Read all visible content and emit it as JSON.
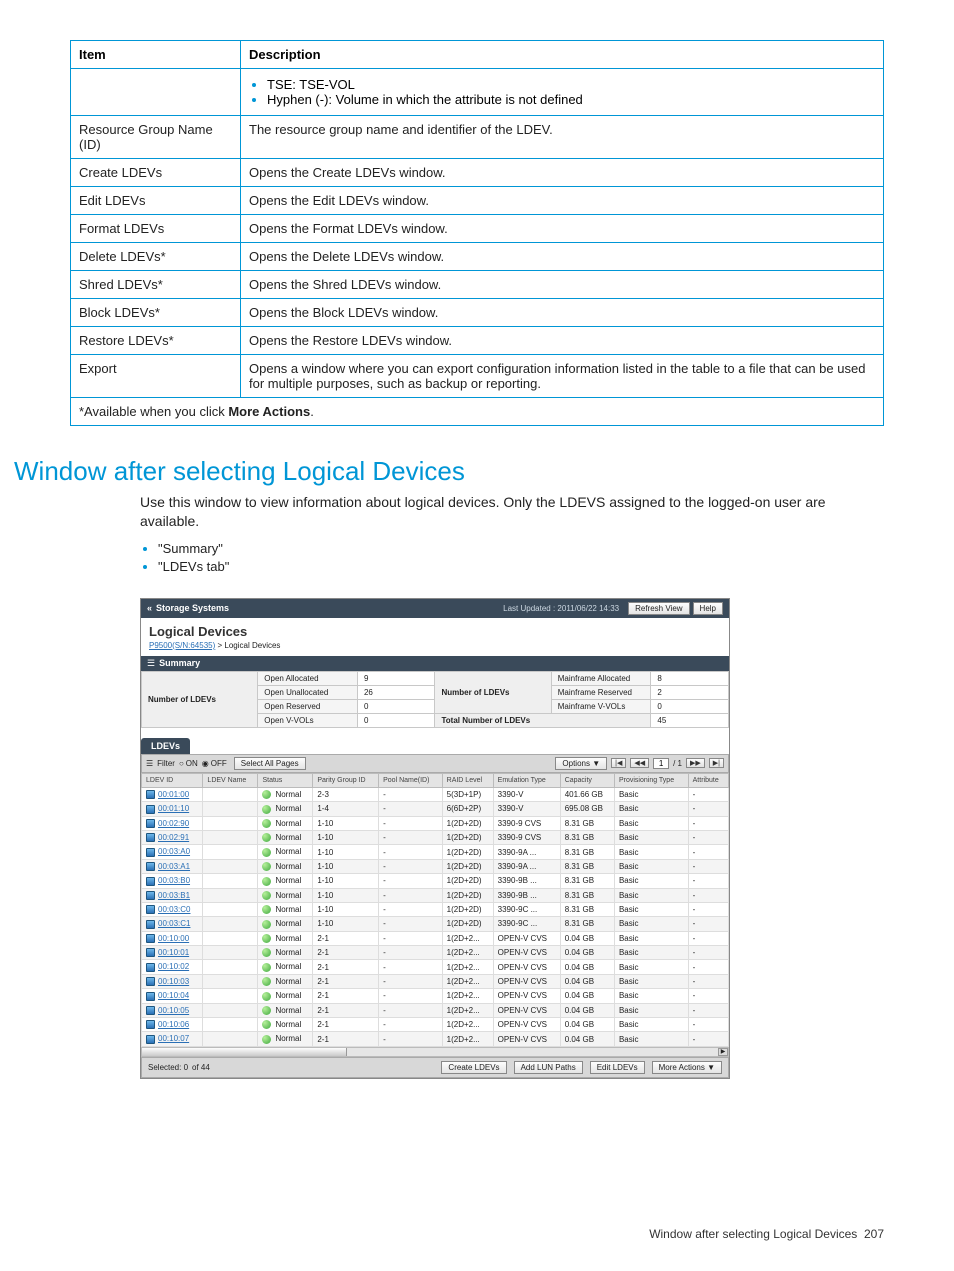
{
  "def_table": {
    "headers": [
      "Item",
      "Description"
    ],
    "rows": [
      {
        "item": "",
        "desc_list": [
          "TSE: TSE-VOL",
          "Hyphen (-): Volume in which the attribute is not defined"
        ]
      },
      {
        "item": "Resource Group Name (ID)",
        "desc": "The resource group name and identifier of the LDEV."
      },
      {
        "item": "Create LDEVs",
        "desc": "Opens the Create LDEVs window."
      },
      {
        "item": "Edit LDEVs",
        "desc": "Opens the Edit LDEVs window."
      },
      {
        "item": "Format LDEVs",
        "desc": "Opens the Format LDEVs window."
      },
      {
        "item": "Delete LDEVs*",
        "desc": "Opens the Delete LDEVs window."
      },
      {
        "item": "Shred LDEVs*",
        "desc": "Opens the Shred LDEVs window."
      },
      {
        "item": "Block LDEVs*",
        "desc": "Opens the Block LDEVs window."
      },
      {
        "item": "Restore LDEVs*",
        "desc": "Opens the Restore LDEVs window."
      },
      {
        "item": "Export",
        "desc": "Opens a window where you can export configuration information listed in the table to a file that can be used for multiple purposes, such as backup or reporting."
      }
    ],
    "footnote_prefix": "*Available when you click ",
    "footnote_bold": "More Actions",
    "footnote_suffix": "."
  },
  "section_title": "Window after selecting Logical Devices",
  "section_desc": "Use this window to view information about logical devices. Only the LDEVS assigned to the logged-on user are available.",
  "section_links": [
    "\"Summary\"",
    "\"LDEVs tab\""
  ],
  "app": {
    "back_label": "Storage Systems",
    "last_updated": "Last Updated : 2011/06/22 14:33",
    "refresh": "Refresh View",
    "help": "Help",
    "title": "Logical Devices",
    "breadcrumb_link": "P9500(S/N:64535)",
    "breadcrumb_sep": " > ",
    "breadcrumb_current": "Logical Devices",
    "summary_label": "Summary",
    "summary": {
      "left_label": "Number of LDEVs",
      "left_rows": [
        {
          "sub": "Open Allocated",
          "val": "9"
        },
        {
          "sub": "Open Unallocated",
          "val": "26"
        },
        {
          "sub": "Open Reserved",
          "val": "0"
        },
        {
          "sub": "Open V-VOLs",
          "val": "0"
        }
      ],
      "mid_label": "Number of LDEVs",
      "right_rows": [
        {
          "sub": "Mainframe Allocated",
          "val": "8"
        },
        {
          "sub": "Mainframe Reserved",
          "val": "2"
        },
        {
          "sub": "Mainframe V-VOLs",
          "val": "0"
        }
      ],
      "total_label": "Total Number of LDEVs",
      "total_val": "45"
    },
    "tab": "LDEVs",
    "toolbar": {
      "filter": "Filter",
      "on": "ON",
      "off": "OFF",
      "select_all": "Select All Pages",
      "options": "Options",
      "page_current": "1",
      "page_total": "/ 1"
    },
    "grid_headers": [
      "LDEV ID",
      "LDEV Name",
      "Status",
      "Parity Group ID",
      "Pool Name(ID)",
      "RAID Level",
      "Emulation Type",
      "Capacity",
      "Provisioning Type",
      "Attribute"
    ],
    "grid_rows": [
      {
        "id": "00:01:00",
        "name": "",
        "status": "Normal",
        "pg": "2-3",
        "pool": "-",
        "raid": "5(3D+1P)",
        "emu": "3390-V",
        "cap": "401.66 GB",
        "prov": "Basic",
        "attr": "-"
      },
      {
        "id": "00:01:10",
        "name": "",
        "status": "Normal",
        "pg": "1-4",
        "pool": "-",
        "raid": "6(6D+2P)",
        "emu": "3390-V",
        "cap": "695.08 GB",
        "prov": "Basic",
        "attr": "-"
      },
      {
        "id": "00:02:90",
        "name": "",
        "status": "Normal",
        "pg": "1-10",
        "pool": "-",
        "raid": "1(2D+2D)",
        "emu": "3390-9 CVS",
        "cap": "8.31 GB",
        "prov": "Basic",
        "attr": "-"
      },
      {
        "id": "00:02:91",
        "name": "",
        "status": "Normal",
        "pg": "1-10",
        "pool": "-",
        "raid": "1(2D+2D)",
        "emu": "3390-9 CVS",
        "cap": "8.31 GB",
        "prov": "Basic",
        "attr": "-"
      },
      {
        "id": "00:03:A0",
        "name": "",
        "status": "Normal",
        "pg": "1-10",
        "pool": "-",
        "raid": "1(2D+2D)",
        "emu": "3390-9A ...",
        "cap": "8.31 GB",
        "prov": "Basic",
        "attr": "-"
      },
      {
        "id": "00:03:A1",
        "name": "",
        "status": "Normal",
        "pg": "1-10",
        "pool": "-",
        "raid": "1(2D+2D)",
        "emu": "3390-9A ...",
        "cap": "8.31 GB",
        "prov": "Basic",
        "attr": "-"
      },
      {
        "id": "00:03:B0",
        "name": "",
        "status": "Normal",
        "pg": "1-10",
        "pool": "-",
        "raid": "1(2D+2D)",
        "emu": "3390-9B ...",
        "cap": "8.31 GB",
        "prov": "Basic",
        "attr": "-"
      },
      {
        "id": "00:03:B1",
        "name": "",
        "status": "Normal",
        "pg": "1-10",
        "pool": "-",
        "raid": "1(2D+2D)",
        "emu": "3390-9B ...",
        "cap": "8.31 GB",
        "prov": "Basic",
        "attr": "-"
      },
      {
        "id": "00:03:C0",
        "name": "",
        "status": "Normal",
        "pg": "1-10",
        "pool": "-",
        "raid": "1(2D+2D)",
        "emu": "3390-9C ...",
        "cap": "8.31 GB",
        "prov": "Basic",
        "attr": "-"
      },
      {
        "id": "00:03:C1",
        "name": "",
        "status": "Normal",
        "pg": "1-10",
        "pool": "-",
        "raid": "1(2D+2D)",
        "emu": "3390-9C ...",
        "cap": "8.31 GB",
        "prov": "Basic",
        "attr": "-"
      },
      {
        "id": "00:10:00",
        "name": "",
        "status": "Normal",
        "pg": "2-1",
        "pool": "-",
        "raid": "1(2D+2...",
        "emu": "OPEN-V CVS",
        "cap": "0.04 GB",
        "prov": "Basic",
        "attr": "-"
      },
      {
        "id": "00:10:01",
        "name": "",
        "status": "Normal",
        "pg": "2-1",
        "pool": "-",
        "raid": "1(2D+2...",
        "emu": "OPEN-V CVS",
        "cap": "0.04 GB",
        "prov": "Basic",
        "attr": "-"
      },
      {
        "id": "00:10:02",
        "name": "",
        "status": "Normal",
        "pg": "2-1",
        "pool": "-",
        "raid": "1(2D+2...",
        "emu": "OPEN-V CVS",
        "cap": "0.04 GB",
        "prov": "Basic",
        "attr": "-"
      },
      {
        "id": "00:10:03",
        "name": "",
        "status": "Normal",
        "pg": "2-1",
        "pool": "-",
        "raid": "1(2D+2...",
        "emu": "OPEN-V CVS",
        "cap": "0.04 GB",
        "prov": "Basic",
        "attr": "-"
      },
      {
        "id": "00:10:04",
        "name": "",
        "status": "Normal",
        "pg": "2-1",
        "pool": "-",
        "raid": "1(2D+2...",
        "emu": "OPEN-V CVS",
        "cap": "0.04 GB",
        "prov": "Basic",
        "attr": "-"
      },
      {
        "id": "00:10:05",
        "name": "",
        "status": "Normal",
        "pg": "2-1",
        "pool": "-",
        "raid": "1(2D+2...",
        "emu": "OPEN-V CVS",
        "cap": "0.04 GB",
        "prov": "Basic",
        "attr": "-"
      },
      {
        "id": "00:10:06",
        "name": "",
        "status": "Normal",
        "pg": "2-1",
        "pool": "-",
        "raid": "1(2D+2...",
        "emu": "OPEN-V CVS",
        "cap": "0.04 GB",
        "prov": "Basic",
        "attr": "-"
      },
      {
        "id": "00:10:07",
        "name": "",
        "status": "Normal",
        "pg": "2-1",
        "pool": "-",
        "raid": "1(2D+2...",
        "emu": "OPEN-V CVS",
        "cap": "0.04 GB",
        "prov": "Basic",
        "attr": "-"
      }
    ],
    "footer": {
      "selected": "Selected: 0",
      "of": "of 44",
      "create": "Create LDEVs",
      "add_lun": "Add LUN Paths",
      "edit": "Edit LDEVs",
      "more": "More Actions"
    }
  },
  "page_footer_text": "Window after selecting Logical Devices",
  "page_number": "207"
}
